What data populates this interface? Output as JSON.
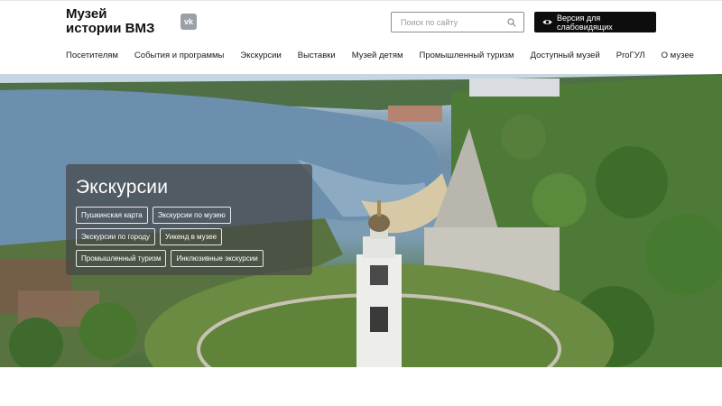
{
  "header": {
    "logo_line1": "Музей",
    "logo_line2": "истории ВМЗ",
    "vk_icon": "vk-icon",
    "search": {
      "placeholder": "Поиск по сайту",
      "value": ""
    },
    "blind_version_label": "Версия для слабовидящих"
  },
  "nav": {
    "items": [
      "Посетителям",
      "События и программы",
      "Экскурсии",
      "Выставки",
      "Музей детям",
      "Промышленный туризм",
      "Доступный музей",
      "ProГУЛ",
      "О музее"
    ]
  },
  "hero": {
    "title": "Экскурсии",
    "tags": [
      "Пушкинская карта",
      "Экскурсии по музею",
      "Экскурсии по городу",
      "Уикенд в музее",
      "Промышленный туризм",
      "Инклюзивные экскурсии"
    ]
  }
}
